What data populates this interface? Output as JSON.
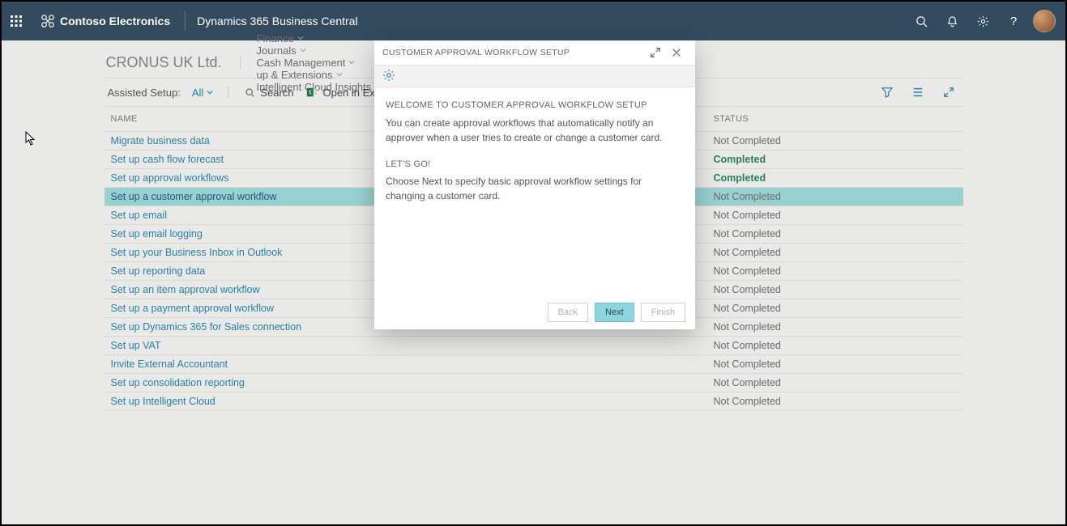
{
  "header": {
    "org_name": "Contoso Electronics",
    "app_name": "Dynamics 365 Business Central"
  },
  "company": {
    "name": "CRONUS UK Ltd."
  },
  "nav": [
    {
      "label": "Finance"
    },
    {
      "label": "Journals"
    },
    {
      "label": "Cash Management"
    },
    {
      "label": "up & Extensions"
    },
    {
      "label": "Intelligent Cloud Insights"
    }
  ],
  "toolbar": {
    "label": "Assisted Setup:",
    "filter": "All",
    "search": "Search",
    "excel": "Open in Excel"
  },
  "columns": {
    "name": "NAME",
    "status": "STATUS"
  },
  "rows": [
    {
      "name": "Migrate business data",
      "status": "Not Completed",
      "completed": false,
      "selected": false
    },
    {
      "name": "Set up cash flow forecast",
      "status": "Completed",
      "completed": true,
      "selected": false
    },
    {
      "name": "Set up approval workflows",
      "status": "Completed",
      "completed": true,
      "selected": false
    },
    {
      "name": "Set up a customer approval workflow",
      "status": "Not Completed",
      "completed": false,
      "selected": true
    },
    {
      "name": "Set up email",
      "status": "Not Completed",
      "completed": false,
      "selected": false
    },
    {
      "name": "Set up email logging",
      "status": "Not Completed",
      "completed": false,
      "selected": false
    },
    {
      "name": "Set up your Business Inbox in Outlook",
      "status": "Not Completed",
      "completed": false,
      "selected": false
    },
    {
      "name": "Set up reporting data",
      "status": "Not Completed",
      "completed": false,
      "selected": false
    },
    {
      "name": "Set up an item approval workflow",
      "status": "Not Completed",
      "completed": false,
      "selected": false
    },
    {
      "name": "Set up a payment approval workflow",
      "status": "Not Completed",
      "completed": false,
      "selected": false
    },
    {
      "name": "Set up Dynamics 365 for Sales connection",
      "status": "Not Completed",
      "completed": false,
      "selected": false
    },
    {
      "name": "Set up VAT",
      "status": "Not Completed",
      "completed": false,
      "selected": false
    },
    {
      "name": "Invite External Accountant",
      "status": "Not Completed",
      "completed": false,
      "selected": false
    },
    {
      "name": "Set up consolidation reporting",
      "status": "Not Completed",
      "completed": false,
      "selected": false
    },
    {
      "name": "Set up Intelligent Cloud",
      "status": "Not Completed",
      "completed": false,
      "selected": false
    }
  ],
  "modal": {
    "title": "CUSTOMER APPROVAL WORKFLOW SETUP",
    "welcome_heading": "WELCOME TO CUSTOMER APPROVAL WORKFLOW SETUP",
    "welcome_text": "You can create approval workflows that automatically notify an approver when a user tries to create or change a customer card.",
    "letsgo_heading": "LET'S GO!",
    "letsgo_text": "Choose Next to specify basic approval workflow settings for changing a customer card.",
    "buttons": {
      "back": "Back",
      "next": "Next",
      "finish": "Finish"
    }
  }
}
